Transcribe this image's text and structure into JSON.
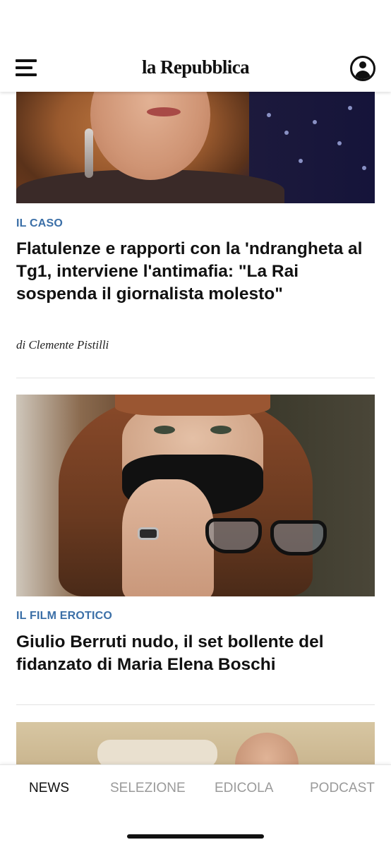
{
  "header": {
    "logo": "la Repubblica",
    "menu_icon": "hamburger-menu-icon",
    "profile_icon": "user-profile-icon"
  },
  "articles": [
    {
      "kicker": "IL CASO",
      "title": "Flatulenze e rapporti con la 'ndrangheta al Tg1, interviene l'antimafia: \"La Rai sospenda il giornalista molesto\"",
      "byline": "di Clemente Pistilli"
    },
    {
      "kicker": "IL FILM EROTICO",
      "title": "Giulio Berruti nudo, il set bollente del fidanzato di Maria Elena Boschi"
    }
  ],
  "bottom_nav": {
    "items": [
      {
        "label": "NEWS",
        "active": true
      },
      {
        "label": "SELEZIONE",
        "active": false
      },
      {
        "label": "EDICOLA",
        "active": false
      },
      {
        "label": "PODCAST",
        "active": false
      }
    ]
  },
  "colors": {
    "kicker": "#3b6fa7",
    "nav_active": "#111111",
    "nav_inactive": "#9a9a9a"
  }
}
